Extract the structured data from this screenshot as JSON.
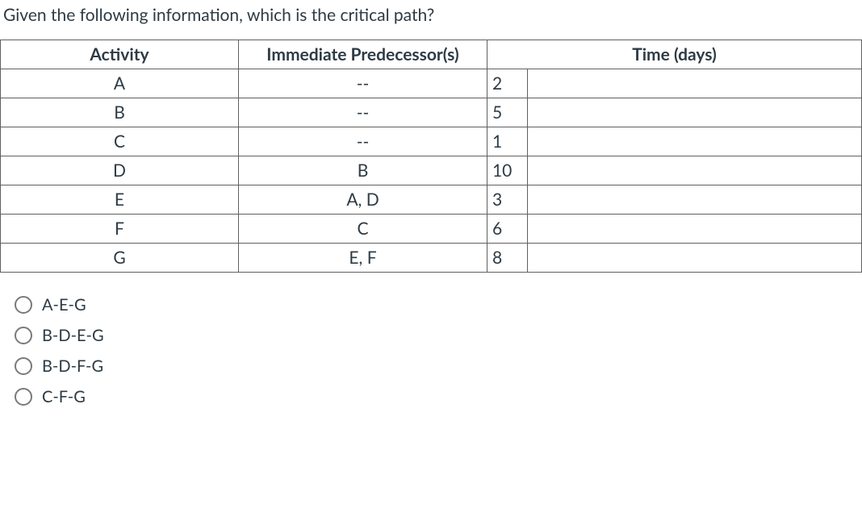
{
  "question": "Given the following information, which is the critical path?",
  "headers": {
    "activity": "Activity",
    "predecessor": "Immediate Predecessor(s)",
    "time": "Time (days)"
  },
  "rows": [
    {
      "activity": "A",
      "predecessor": "--",
      "time": "2"
    },
    {
      "activity": "B",
      "predecessor": "--",
      "time": "5"
    },
    {
      "activity": "C",
      "predecessor": "--",
      "time": "1"
    },
    {
      "activity": "D",
      "predecessor": "B",
      "time": "10"
    },
    {
      "activity": "E",
      "predecessor": "A, D",
      "time": "3"
    },
    {
      "activity": "F",
      "predecessor": "C",
      "time": "6"
    },
    {
      "activity": "G",
      "predecessor": "E, F",
      "time": "8"
    }
  ],
  "options": [
    "A-E-G",
    "B-D-E-G",
    "B-D-F-G",
    "C-F-G"
  ]
}
